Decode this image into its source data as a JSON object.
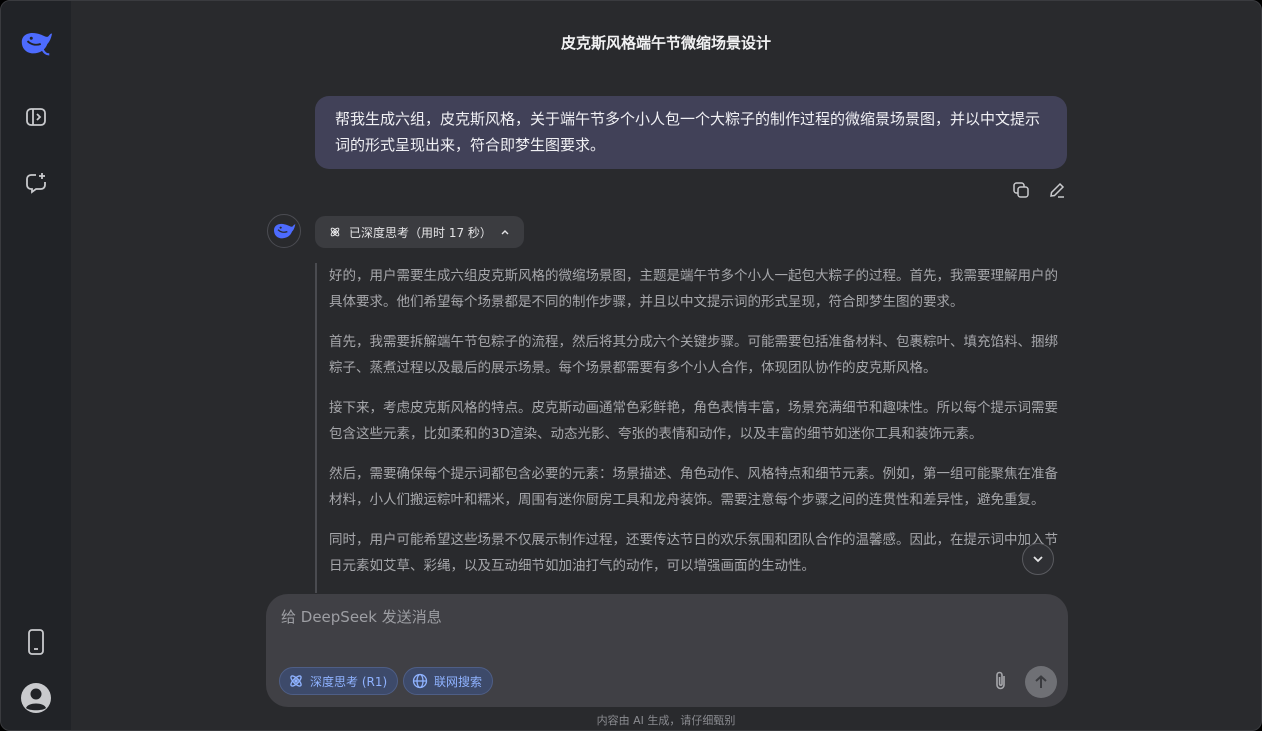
{
  "sidebar": {
    "logo_icon": "deepseek-whale-icon",
    "items": [
      {
        "icon": "sidebar-toggle-icon"
      },
      {
        "icon": "new-chat-icon"
      }
    ],
    "bottom": [
      {
        "icon": "phone-icon"
      },
      {
        "icon": "user-avatar-icon"
      }
    ]
  },
  "header": {
    "title": "皮克斯风格端午节微缩场景设计"
  },
  "user_message": {
    "text": "帮我生成六组，皮克斯风格，关于端午节多个小人包一个大粽子的制作过程的微缩景场景图，并以中文提示词的形式呈现出来，符合即梦生图要求。",
    "actions": [
      "copy-icon",
      "edit-icon"
    ]
  },
  "assistant": {
    "think_label": "已深度思考（用时 17 秒）",
    "thoughts": [
      "好的，用户需要生成六组皮克斯风格的微缩场景图，主题是端午节多个小人一起包大粽子的过程。首先，我需要理解用户的具体要求。他们希望每个场景都是不同的制作步骤，并且以中文提示词的形式呈现，符合即梦生图的要求。",
      "首先，我需要拆解端午节包粽子的流程，然后将其分成六个关键步骤。可能需要包括准备材料、包裹粽叶、填充馅料、捆绑粽子、蒸煮过程以及最后的展示场景。每个场景都需要有多个小人合作，体现团队协作的皮克斯风格。",
      "接下来，考虑皮克斯风格的特点。皮克斯动画通常色彩鲜艳，角色表情丰富，场景充满细节和趣味性。所以每个提示词需要包含这些元素，比如柔和的3D渲染、动态光影、夸张的表情和动作，以及丰富的细节如迷你工具和装饰元素。",
      "然后，需要确保每个提示词都包含必要的元素：场景描述、角色动作、风格特点和细节元素。例如，第一组可能聚焦在准备材料，小人们搬运粽叶和糯米，周围有迷你厨房工具和龙舟装饰。需要注意每个步骤之间的连贯性和差异性，避免重复。",
      "同时，用户可能希望这些场景不仅展示制作过程，还要传达节日的欢乐氛围和团队合作的温馨感。因此，在提示词中加入节日元素如艾草、彩绳，以及互动细节如加油打气的动作，可以增强画面的生动性。"
    ]
  },
  "composer": {
    "placeholder": "给 DeepSeek 发送消息",
    "deep_think_label": "深度思考 (R1)",
    "web_search_label": "联网搜索"
  },
  "footer": {
    "note": "内容由 AI 生成，请仔细甄别"
  },
  "colors": {
    "background": "#292a2d",
    "sidebar": "#212327",
    "user_bubble": "#414158",
    "accent": "#4d6bfe",
    "chip_text": "#8fb2ff"
  }
}
